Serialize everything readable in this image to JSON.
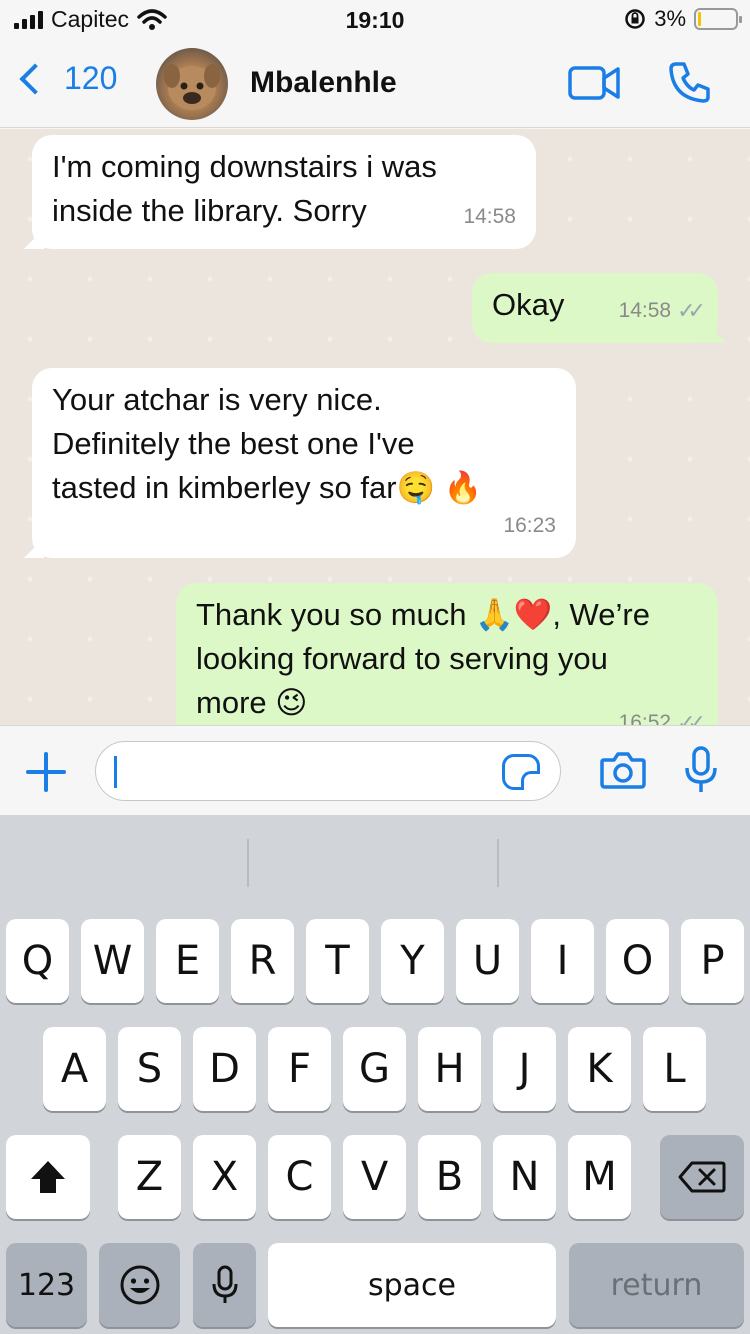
{
  "status_bar": {
    "carrier": "Capitec",
    "time": "19:10",
    "battery_percent": "3%"
  },
  "header": {
    "back_count": "120",
    "contact_name": "Mbalenhle",
    "icons": [
      "back-chevron-icon",
      "video-call-icon",
      "phone-call-icon"
    ]
  },
  "messages": [
    {
      "direction": "in",
      "line1": "I'm coming downstairs i was",
      "line2": "inside the library. Sorry",
      "time": "14:58"
    },
    {
      "direction": "out",
      "text": "Okay",
      "time": "14:58",
      "read_ticks": "✓✓"
    },
    {
      "direction": "in",
      "line1": "Your atchar is very nice.",
      "line2": "Definitely the best one I've",
      "line3": "tasted in kimberley so far🤤 🔥",
      "time": "16:23"
    },
    {
      "direction": "out",
      "line1": "Thank you so much 🙏❤️, We’re",
      "line2": "looking forward to serving you",
      "line3": "more 😉",
      "time": "16:52",
      "read_ticks": "✓✓"
    }
  ],
  "input": {
    "placeholder": "",
    "icons": [
      "plus-icon",
      "sticker-icon",
      "camera-icon",
      "microphone-icon"
    ]
  },
  "keyboard": {
    "row1": [
      "Q",
      "W",
      "E",
      "R",
      "T",
      "Y",
      "U",
      "I",
      "O",
      "P"
    ],
    "row2": [
      "A",
      "S",
      "D",
      "F",
      "G",
      "H",
      "J",
      "K",
      "L"
    ],
    "row3": [
      "Z",
      "X",
      "C",
      "V",
      "B",
      "N",
      "M"
    ],
    "numbers_key": "123",
    "space_key": "space",
    "return_key": "return",
    "icons": [
      "shift-icon",
      "backspace-icon",
      "emoji-icon",
      "dictation-mic-icon"
    ]
  },
  "colors": {
    "accent": "#1a7ee6",
    "outgoing_bubble": "#dcf8c6",
    "incoming_bubble": "#ffffff",
    "chat_background": "#ece5dd",
    "keyboard_background": "#d1d4d9"
  }
}
